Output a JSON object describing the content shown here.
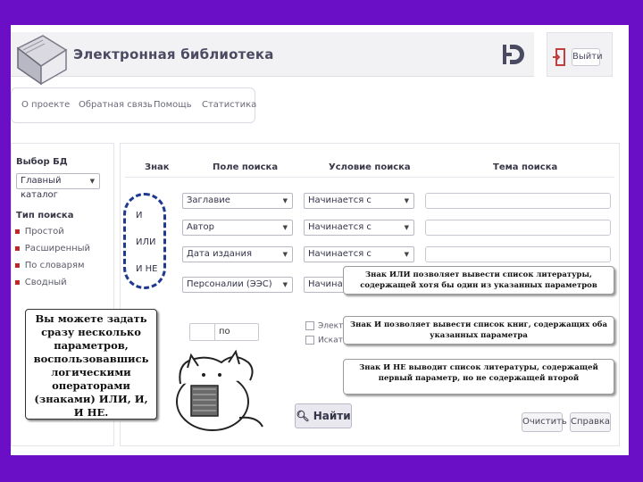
{
  "header": {
    "title": "Электронная библиотека",
    "exit_label": "Выйти"
  },
  "nav": {
    "items": [
      "О проекте",
      "Обратная связь",
      "Помощь",
      "Статистика"
    ]
  },
  "sidebar": {
    "db_label": "Выбор БД",
    "db_value": "Главный каталог",
    "search_type_label": "Тип поиска",
    "search_types": [
      "Простой",
      "Расширенный",
      "По словарям",
      "Сводный"
    ]
  },
  "table": {
    "headers": [
      "Знак",
      "Поле поиска",
      "Условие поиска",
      "Тема поиска"
    ],
    "rows": [
      {
        "sign": "",
        "field": "Заглавие",
        "condition": "Начинается с"
      },
      {
        "sign": "И",
        "field": "Автор",
        "condition": "Начинается с"
      },
      {
        "sign": "ИЛИ",
        "field": "Дата издания",
        "condition": "Начинается с"
      },
      {
        "sign": "И НЕ",
        "field": "Персоналии (ЭЭС)",
        "condition": "Начинается с"
      }
    ]
  },
  "date_range": {
    "to_label": "по"
  },
  "checkboxes": [
    "Электр...",
    "Искать..."
  ],
  "buttons": {
    "find": "Найти",
    "clear": "Очистить",
    "help": "Справка"
  },
  "callouts": {
    "left": "Вы можете задать сразу несколько параметров, воспользовавшись логическими операторами (знаками) ИЛИ, И, И НЕ.",
    "or": "Знак ИЛИ позволяет вывести список литературы, содержащей хотя бы один из указанных параметров",
    "and": "Знак И позволяет вывести список книг, содержащих оба указанных параметра",
    "and_not": "Знак И НЕ выводит список литературы, содержащей первый параметр, но не содержащей второй"
  },
  "colors": {
    "background": "#6a0fc6",
    "oval": "#1f3a8e",
    "bullet": "#c02525"
  }
}
